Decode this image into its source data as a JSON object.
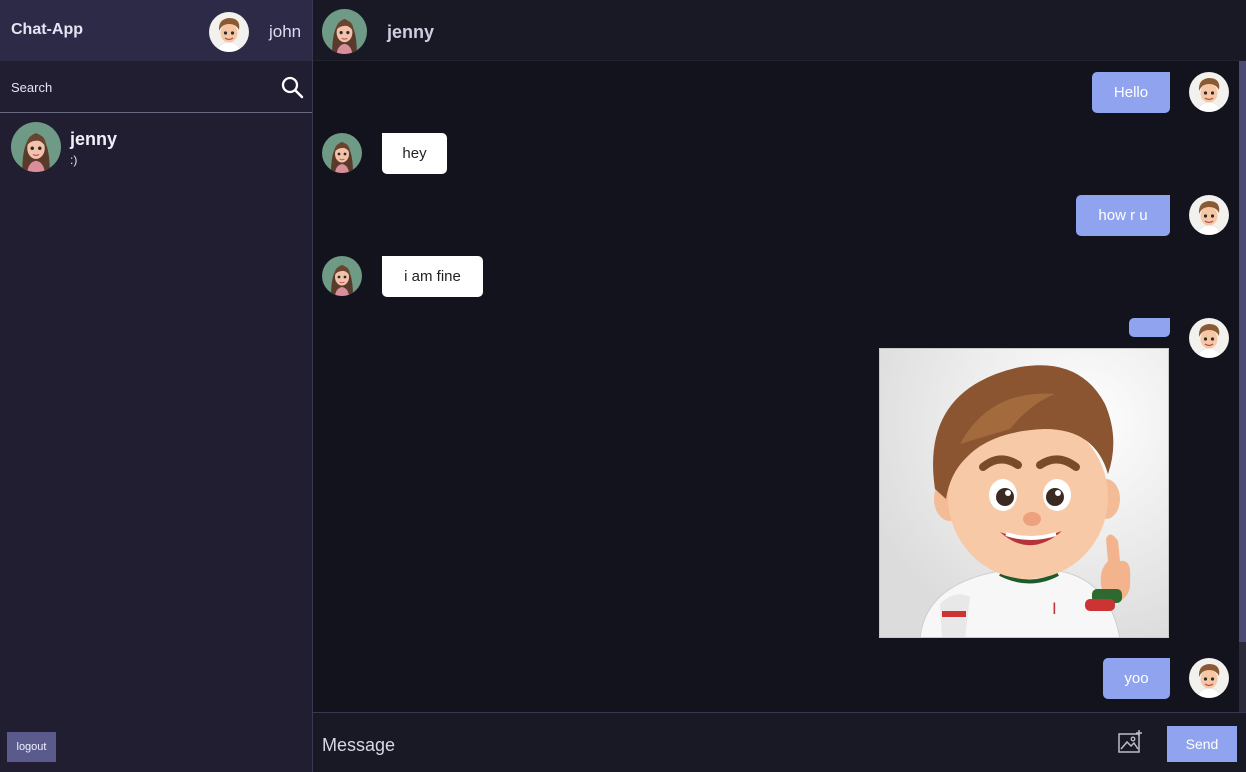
{
  "app": {
    "brand": "Chat-App"
  },
  "user": {
    "name": "john",
    "avatar": "boy-avatar"
  },
  "search": {
    "placeholder": "Search",
    "icon": "search-icon"
  },
  "contacts": [
    {
      "name": "jenny",
      "last_message": ":)",
      "avatar": "girl-avatar"
    }
  ],
  "sidebar": {
    "logout_label": "logout"
  },
  "chat_header": {
    "name": "jenny",
    "avatar": "girl-avatar"
  },
  "messages": [
    {
      "from": "me",
      "text": "Hello"
    },
    {
      "from": "them",
      "text": "hey"
    },
    {
      "from": "me",
      "text": "how r u"
    },
    {
      "from": "them",
      "text": "i am fine"
    },
    {
      "from": "me",
      "text": "",
      "image": "cartoon boy giving thumbs up"
    },
    {
      "from": "me",
      "text": "yoo"
    }
  ],
  "composer": {
    "placeholder": "Message",
    "image_icon": "image-upload-icon",
    "send_label": "Send"
  },
  "colors": {
    "outgoing_bubble": "#8fa3ef",
    "incoming_bubble": "#ffffff",
    "sidebar": "#201e30",
    "chat_bg": "#13131e",
    "header": "#2c2a47",
    "logout": "#5b5a8c"
  }
}
